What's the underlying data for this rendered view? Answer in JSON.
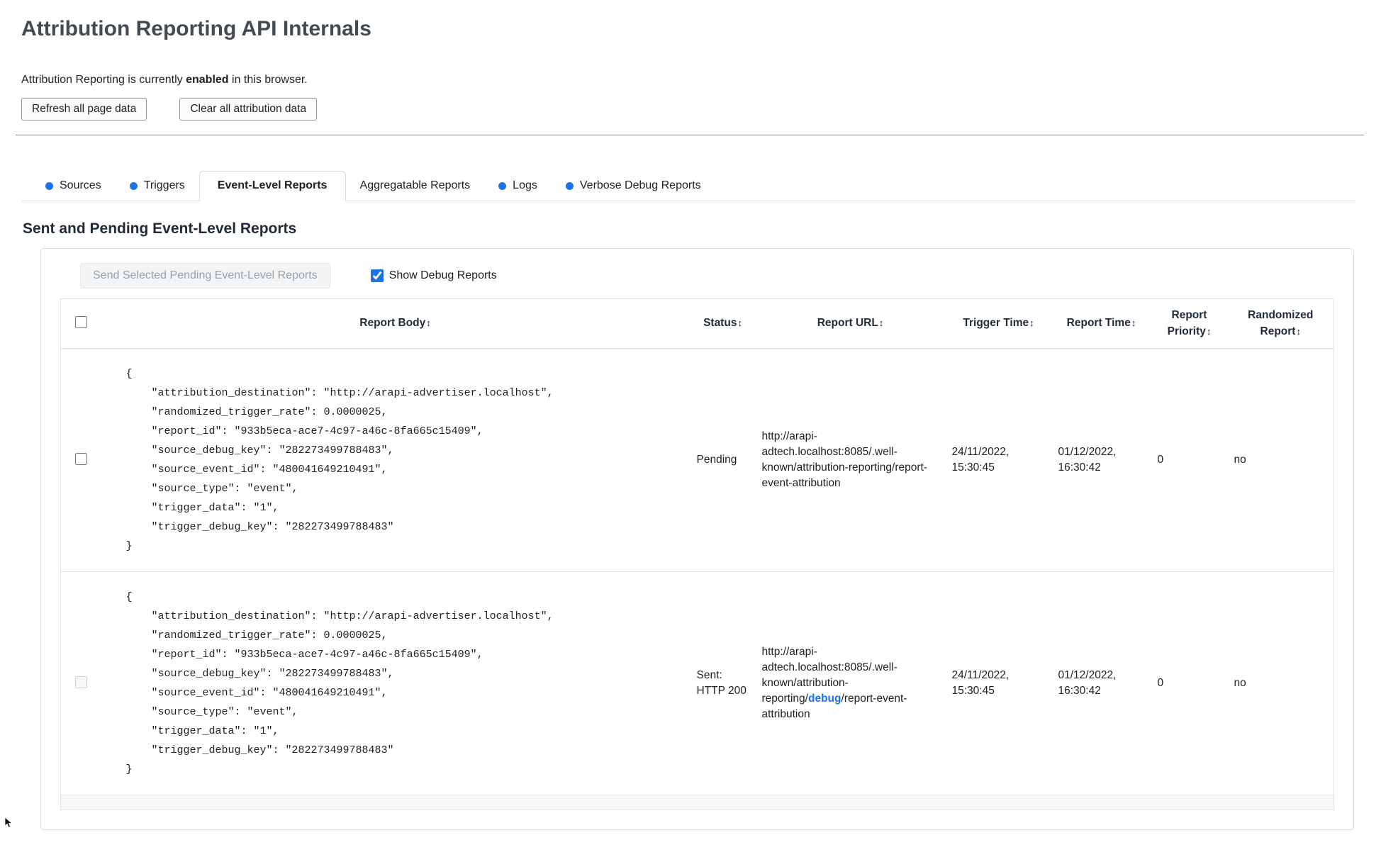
{
  "colors": {
    "accent": "#1a73e8"
  },
  "page": {
    "title": "Attribution Reporting API Internals",
    "status_prefix": "Attribution Reporting is currently ",
    "status_bold": "enabled",
    "status_suffix": " in this browser.",
    "refresh_button": "Refresh all page data",
    "clear_button": "Clear all attribution data"
  },
  "tabs": [
    {
      "label": "Sources",
      "dot": true,
      "selected": false
    },
    {
      "label": "Triggers",
      "dot": true,
      "selected": false
    },
    {
      "label": "Event-Level Reports",
      "dot": false,
      "selected": true
    },
    {
      "label": "Aggregatable Reports",
      "dot": false,
      "selected": false
    },
    {
      "label": "Logs",
      "dot": true,
      "selected": false
    },
    {
      "label": "Verbose Debug Reports",
      "dot": true,
      "selected": false
    }
  ],
  "section": {
    "heading": "Sent and Pending Event-Level Reports",
    "send_button": "Send Selected Pending Event-Level Reports",
    "show_debug_label": "Show Debug Reports",
    "show_debug_checked": true
  },
  "table": {
    "sort_glyph": "↕",
    "headers": [
      "Report Body",
      "Status",
      "Report URL",
      "Trigger Time",
      "Report Time",
      "Report Priority",
      "Randomized Report"
    ],
    "rows": [
      {
        "checkbox": {
          "checked": false,
          "disabled": false
        },
        "report_body": "{\n    \"attribution_destination\": \"http://arapi-advertiser.localhost\",\n    \"randomized_trigger_rate\": 0.0000025,\n    \"report_id\": \"933b5eca-ace7-4c97-a46c-8fa665c15409\",\n    \"source_debug_key\": \"282273499788483\",\n    \"source_event_id\": \"480041649210491\",\n    \"source_type\": \"event\",\n    \"trigger_data\": \"1\",\n    \"trigger_debug_key\": \"282273499788483\"\n}",
        "status": "Pending",
        "report_url": "http://arapi-adtech.localhost:8085/.well-known/attribution-reporting/report-event-attribution",
        "trigger_time": "24/11/2022, 15:30:45",
        "report_time": "01/12/2022, 16:30:42",
        "report_priority": "0",
        "randomized_report": "no"
      },
      {
        "checkbox": {
          "checked": false,
          "disabled": true
        },
        "report_body": "{\n    \"attribution_destination\": \"http://arapi-advertiser.localhost\",\n    \"randomized_trigger_rate\": 0.0000025,\n    \"report_id\": \"933b5eca-ace7-4c97-a46c-8fa665c15409\",\n    \"source_debug_key\": \"282273499788483\",\n    \"source_event_id\": \"480041649210491\",\n    \"source_type\": \"event\",\n    \"trigger_data\": \"1\",\n    \"trigger_debug_key\": \"282273499788483\"\n}",
        "status": "Sent: HTTP 200",
        "report_url_prefix": "http://arapi-adtech.localhost:8085/.well-known/attribution-reporting/",
        "report_url_link": "debug",
        "report_url_suffix": "/report-event-attribution",
        "trigger_time": "24/11/2022, 15:30:45",
        "report_time": "01/12/2022, 16:30:42",
        "report_priority": "0",
        "randomized_report": "no"
      }
    ]
  }
}
